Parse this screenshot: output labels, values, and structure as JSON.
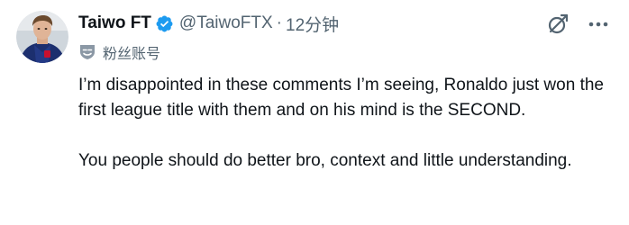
{
  "author": {
    "display_name": "Taiwo FT",
    "handle": "@TaiwoFTX",
    "separator": "·",
    "time": "12分钟",
    "verified": true
  },
  "label": {
    "text": "粉丝账号",
    "icon": "fan-account-badge-icon"
  },
  "actions": {
    "grok_icon": "grok-icon",
    "more_icon": "more-icon"
  },
  "tweet": {
    "paragraphs": [
      "I’m disappointed in these comments I’m seeing, Ronaldo just won the first league title with them and on his mind is the SECOND.",
      "You people should do better bro, context and little understanding."
    ]
  },
  "colors": {
    "text": "#0f1419",
    "secondary": "#536471",
    "verified": "#1d9bf0"
  }
}
